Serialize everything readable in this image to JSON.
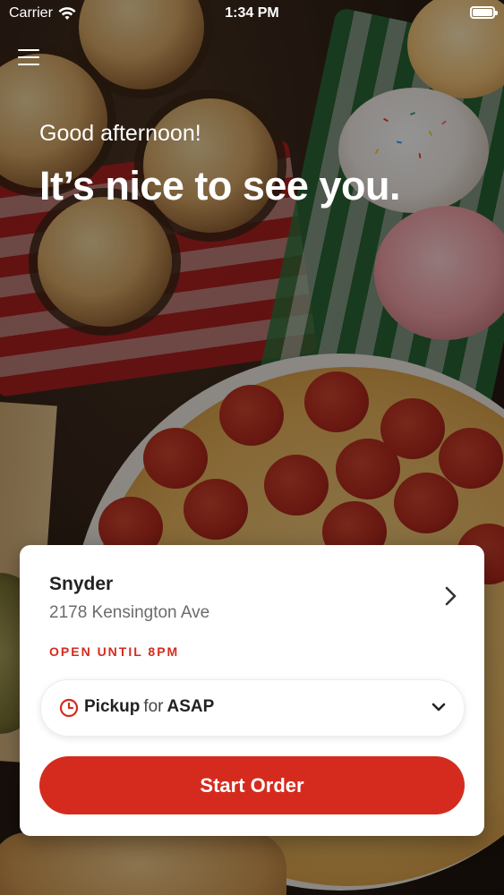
{
  "status_bar": {
    "carrier": "Carrier",
    "time": "1:34 PM",
    "battery_level": 1.0
  },
  "header": {
    "menu_icon": "hamburger-menu-icon",
    "greeting": "Good afternoon!",
    "headline": "It’s nice to see you."
  },
  "store_card": {
    "store_name": "Snyder",
    "address": "2178 Kensington Ave",
    "hours": "OPEN UNTIL 8PM",
    "pickup": {
      "method": "Pickup",
      "connector": "for",
      "time": "ASAP"
    },
    "start_button": "Start Order"
  },
  "colors": {
    "accent": "#D52B1E",
    "card_background": "#FFFFFF",
    "text_primary": "#222222",
    "text_secondary": "#6B6B6B"
  }
}
